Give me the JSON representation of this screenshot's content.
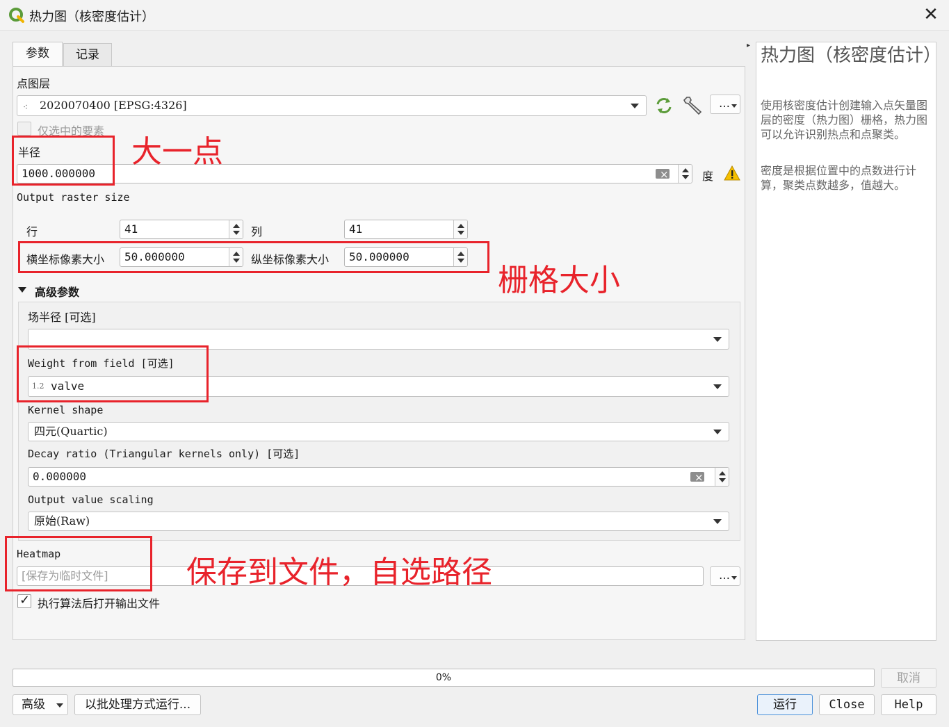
{
  "window": {
    "title": "热力图（核密度估计）",
    "close_glyph": "✕"
  },
  "tabs": [
    {
      "label": "参数"
    },
    {
      "label": "记录"
    }
  ],
  "params": {
    "point_layer_label": "点图层",
    "point_layer_value": "2020070400 [EPSG:4326]",
    "selected_only_label": "仅选中的要素",
    "radius_label": "半径",
    "radius_value": "1000.000000",
    "radius_unit": "度",
    "output_raster_size_label": "Output raster size",
    "rows_label": "行",
    "rows_value": "41",
    "cols_label": "列",
    "cols_value": "41",
    "pixel_x_label": "横坐标像素大小",
    "pixel_x_value": "50.000000",
    "pixel_y_label": "纵坐标像素大小",
    "pixel_y_value": "50.000000",
    "advanced_label": "高级参数",
    "radius_field_label": "场半径 [可选]",
    "radius_field_value": "",
    "weight_field_label": "Weight from field [可选]",
    "weight_field_type": "1.2",
    "weight_field_value": "valve",
    "kernel_shape_label": "Kernel shape",
    "kernel_shape_value": "四元(Quartic)",
    "decay_label": "Decay ratio (Triangular kernels only) [可选]",
    "decay_value": "0.000000",
    "scaling_label": "Output value scaling",
    "scaling_value": "原始(Raw)",
    "heatmap_label": "Heatmap",
    "heatmap_placeholder": "[保存为临时文件]",
    "open_output_label": "执行算法后打开输出文件",
    "open_output_check": "✓"
  },
  "annotations": {
    "radius_note": "大一点",
    "raster_note": "栅格大小",
    "save_note": "保存到文件，自选路径"
  },
  "help": {
    "title": "热力图（核密度估计）",
    "para1": "使用核密度估计创建输入点矢量图层的密度（热力图）栅格，热力图可以允许识别热点和点聚类。",
    "para2": "密度是根据位置中的点数进行计算，聚类点数越多，值越大。"
  },
  "progress": {
    "percent": 0,
    "label": "0%"
  },
  "buttons": {
    "cancel": "取消",
    "advanced": "高级",
    "batch": "以批处理方式运行...",
    "run": "运行",
    "close": "Close",
    "help": "Help",
    "ellipsis": "…"
  },
  "colors": {
    "annotation_red": "#e8232b",
    "qgis_green": "#5c9c3a",
    "warning_yellow": "#f6c000"
  }
}
